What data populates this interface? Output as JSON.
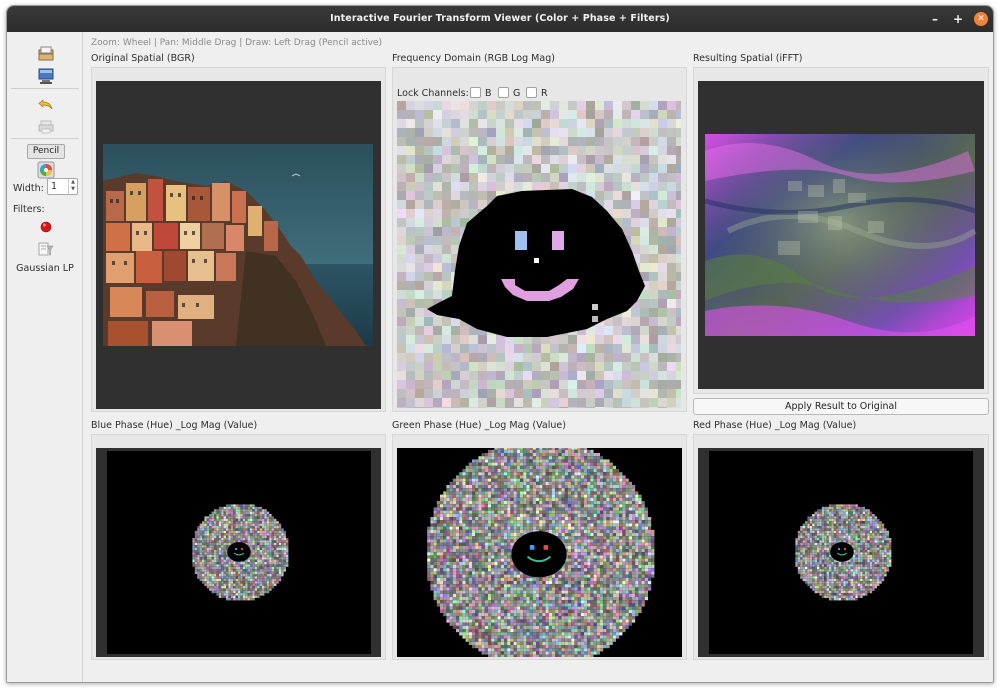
{
  "window": {
    "title": "Interactive Fourier Transform Viewer (Color + Phase + Filters)"
  },
  "window_controls": {
    "minimize": "–",
    "maximize": "+",
    "close": "✕"
  },
  "toolbar": {
    "icons": [
      "open-image-icon",
      "monitor-icon",
      "undo-icon",
      "print-icon",
      "color-wheel-icon",
      "red-dot-icon",
      "filter-icon"
    ],
    "pencil_label": "Pencil",
    "width_label": "Width:",
    "width_value": "1",
    "filters_label": "Filters:",
    "filter_name": "Gaussian LP"
  },
  "hint": "Zoom: Wheel | Pan: Middle Drag | Draw: Left Drag (Pencil active)",
  "panels": {
    "original": {
      "title": "Original Spatial (BGR)"
    },
    "frequency": {
      "title": "Frequency Domain (RGB Log Mag)"
    },
    "result": {
      "title": "Resulting Spatial (iFFT)"
    },
    "blue": {
      "title": "Blue Phase (Hue) _Log Mag (Value)"
    },
    "green": {
      "title": "Green Phase (Hue) _Log Mag (Value)"
    },
    "red": {
      "title": "Red Phase (Hue) _Log Mag (Value)"
    }
  },
  "lock": {
    "label": "Lock Channels:",
    "channels": [
      {
        "name": "B",
        "checked": false
      },
      {
        "name": "G",
        "checked": false
      },
      {
        "name": "R",
        "checked": false
      }
    ]
  },
  "apply_button": "Apply Result to Original",
  "colors": {
    "titlebar": "#2f2f2f",
    "close": "#f0823a",
    "view_bg": "#303030",
    "sky": "#2d5a68",
    "sea": "#25485a"
  }
}
